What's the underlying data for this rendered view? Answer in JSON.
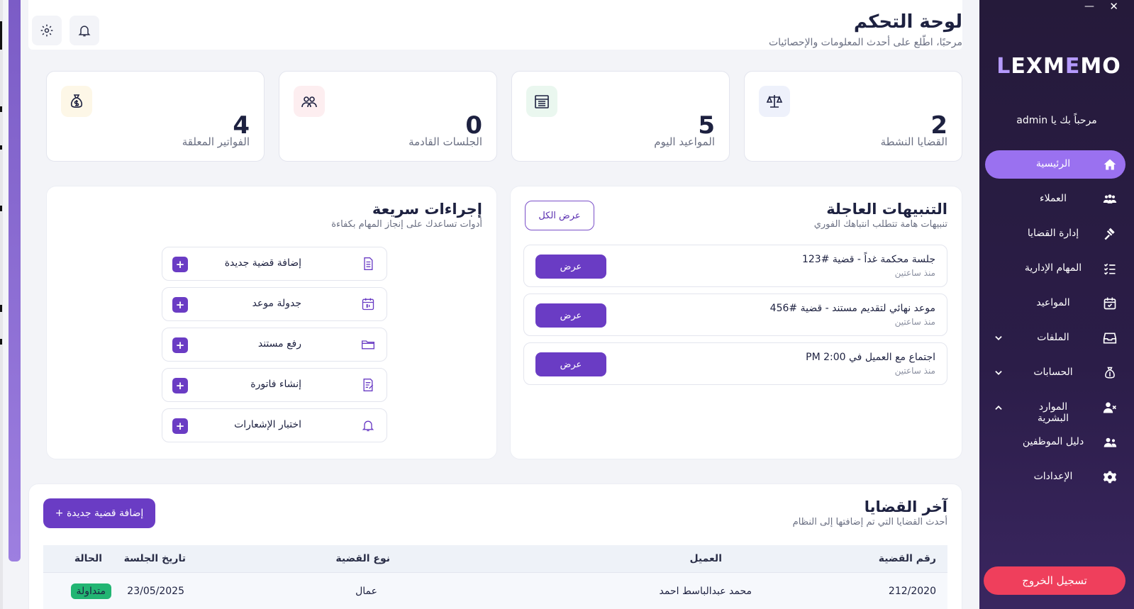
{
  "window": {
    "minimize": "—",
    "close": "✕"
  },
  "header": {
    "title": "لوحة التحكم",
    "subtitle": "مرحبًا، اطّلع على أحدث المعلومات والإحصائيات"
  },
  "stats": [
    {
      "value": "2",
      "label": "القضايا النشطة",
      "icon": "scales-icon",
      "icon_bg": "#eef1fb"
    },
    {
      "value": "5",
      "label": "المواعيد اليوم",
      "icon": "calendar-icon",
      "icon_bg": "#eaf7ef"
    },
    {
      "value": "0",
      "label": "الجلسات القادمة",
      "icon": "people-icon",
      "icon_bg": "#fdeef0"
    },
    {
      "value": "4",
      "label": "الفواتير المعلقة",
      "icon": "money-bag-icon",
      "icon_bg": "#fdf7e7"
    }
  ],
  "alerts": {
    "title": "التنبيهات العاجلة",
    "subtitle": "تنبيهات هامة تتطلب انتباهك الفوري",
    "view_all": "عرض الكل",
    "items": [
      {
        "text": "جلسة محكمة غداً - قضية #123",
        "time": "منذ ساعتين",
        "button": "عرض"
      },
      {
        "text": "موعد نهائي لتقديم مستند - قضية #456",
        "time": "منذ ساعتين",
        "button": "عرض"
      },
      {
        "text": "اجتماع مع العميل في 2:00 PM",
        "time": "منذ ساعتين",
        "button": "عرض"
      }
    ]
  },
  "quick_actions": {
    "title": "إجراءات سريعة",
    "subtitle": "أدوات تساعدك على إنجاز المهام بكفاءة",
    "plus": "+",
    "items": [
      {
        "label": "إضافة قضية جديدة",
        "icon": "document-icon"
      },
      {
        "label": "جدولة موعد",
        "icon": "calendar-31-icon"
      },
      {
        "label": "رفع مستند",
        "icon": "folder-icon"
      },
      {
        "label": "إنشاء فاتورة",
        "icon": "invoice-icon"
      },
      {
        "label": "اختبار الإشعارات",
        "icon": "bell-icon"
      }
    ]
  },
  "recent_cases": {
    "title": "آخر القضايا",
    "subtitle": "أحدث القضايا التي تم إضافتها إلى النظام",
    "add_button": "إضافة قضية جديدة +",
    "columns": [
      "رقم القضية",
      "العميل",
      "نوع القضية",
      "تاريخ الجلسة",
      "الحالة"
    ],
    "rows": [
      {
        "case_no": "212/2020",
        "client": "محمد عبدالباسط احمد",
        "type": "عمال",
        "date": "23/05/2025",
        "status": "متداولة"
      }
    ]
  },
  "sidebar": {
    "logo_a": "L",
    "logo_b": "EXM",
    "logo_c": "E",
    "logo_d": "MO",
    "welcome": "مرحباً بك يا admin",
    "items": [
      {
        "label": "الرئيسية",
        "icon": "home-icon",
        "active": true
      },
      {
        "label": "العملاء",
        "icon": "clients-icon"
      },
      {
        "label": "إدارة القضايا",
        "icon": "gavel-icon"
      },
      {
        "label": "المهام الإدارية",
        "icon": "task-list-icon"
      },
      {
        "label": "المواعيد",
        "icon": "calendar-check-icon"
      },
      {
        "label": "الملفات",
        "icon": "archive-icon",
        "chevron": "down"
      },
      {
        "label": "الحسابات",
        "icon": "money-bag-icon",
        "chevron": "down"
      },
      {
        "label": "الموارد البشرية",
        "icon": "user-remove-icon",
        "chevron": "up"
      },
      {
        "label": "دليل الموظفين",
        "icon": "users-icon"
      },
      {
        "label": "الإعدادات",
        "icon": "gear-icon"
      }
    ],
    "logout": "تسجيل الخروج"
  },
  "colors": {
    "accent": "#6a3cc4",
    "sidebar_active": "#9a71f0",
    "logout": "#ef3f5c",
    "status_green": "#22b573"
  }
}
